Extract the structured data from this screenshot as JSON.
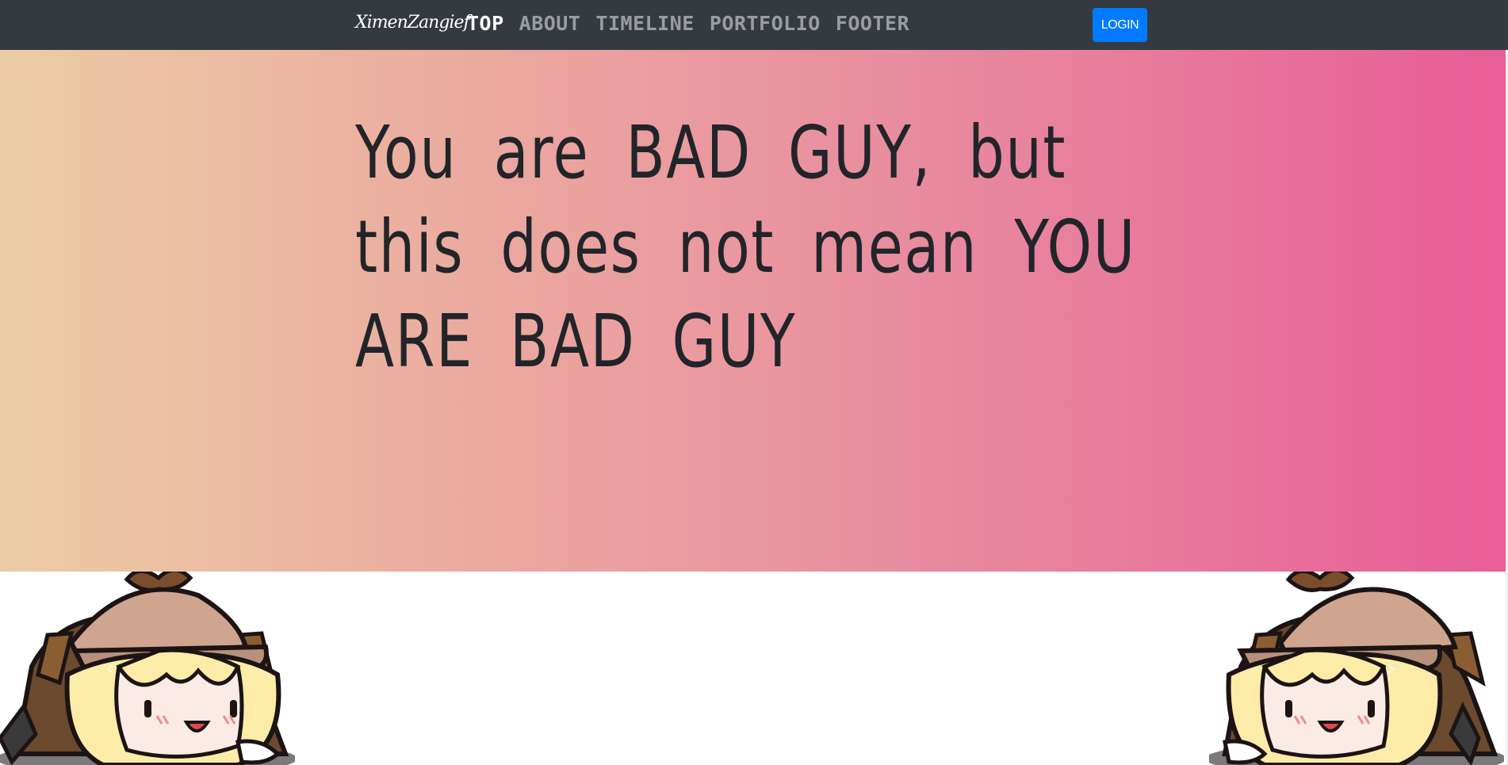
{
  "navbar": {
    "brand": "XimenZangief",
    "links": [
      {
        "label": "TOP",
        "active": true
      },
      {
        "label": "ABOUT",
        "active": false
      },
      {
        "label": "TIMELINE",
        "active": false
      },
      {
        "label": "PORTFOLIO",
        "active": false
      },
      {
        "label": "FOOTER",
        "active": false
      }
    ],
    "login_label": "LOGIN"
  },
  "hero": {
    "heading": "You are BAD GUY, but this does not mean YOU ARE BAD GUY",
    "gradient_colors": [
      "#eccca4",
      "#eba69f",
      "#e8879f",
      "#e85d96"
    ]
  },
  "carousel": {
    "prev_icon": "chevron-left-icon",
    "next_icon": "chevron-right-icon",
    "prev_glyph": "‹",
    "next_glyph": "›"
  },
  "colors": {
    "navbar_bg": "#343a40",
    "login_bg": "#007bff",
    "text_dark": "#212529"
  }
}
